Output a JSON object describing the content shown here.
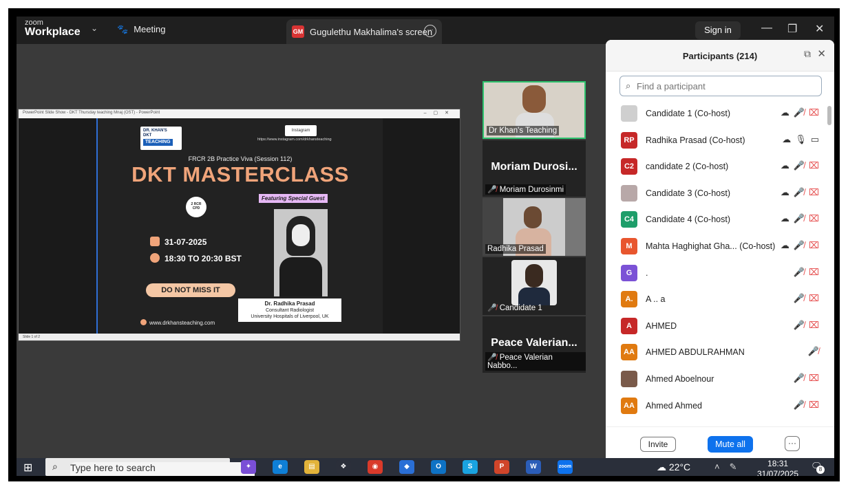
{
  "titlebar": {
    "logo_line1": "zoom",
    "logo_line2": "Workplace",
    "meeting_label": "Meeting",
    "share_tab_avatar": "GM",
    "share_tab_label": "Gugulethu Makhalima's screen",
    "signin_label": "Sign in"
  },
  "slide": {
    "window_title": "PowerPoint Slide Show - DKT Thursday teaching Mnaj (OST) - PowerPoint",
    "footer": "Slide 1 of 2",
    "logo_top": "DR. KHAN'S",
    "logo_mid": "DKT",
    "logo_brand": "TEACHING",
    "instagram": "Instagram",
    "instagram_url": "https://www.instagram.com/drkhansteaching",
    "subtitle": "FRCR 2B Practice Viva (Session 112)",
    "title": "DKT MASTERCLASS",
    "guest_tag": "Featuring Special Guest",
    "cpd_line1": "2 RCR",
    "cpd_line2": "CPD",
    "date": "31-07-2025",
    "time": "18:30 TO 20:30 BST",
    "cta": "DO NOT MISS IT",
    "guest_name": "Dr. Radhika Prasad",
    "guest_role": "Consultant Radiologist",
    "guest_org": "University Hospitals of Liverpool, UK",
    "website": "www.drkhansteaching.com"
  },
  "video_tiles": [
    {
      "name": "Dr Khan's Teaching"
    },
    {
      "big": "Moriam Durosi...",
      "name": "Moriam Durosinmi"
    },
    {
      "name": "Radhika Prasad"
    },
    {
      "name": "Candidate 1"
    },
    {
      "big": "Peace Valerian...",
      "name": "Peace Valerian Nabbo..."
    }
  ],
  "participants": {
    "title": "Participants (214)",
    "search_placeholder": "Find a participant",
    "rows": [
      {
        "avatar": "",
        "color": "#cfcfcf",
        "name": "Candidate 1 (Co-host)"
      },
      {
        "avatar": "RP",
        "color": "#c62828",
        "name": "Radhika Prasad (Co-host)"
      },
      {
        "avatar": "C2",
        "color": "#c62828",
        "name": "candidate 2 (Co-host)"
      },
      {
        "avatar": "",
        "color": "#b8a8a8",
        "name": "Candidate 3 (Co-host)"
      },
      {
        "avatar": "C4",
        "color": "#1e9e6a",
        "name": "Candidate 4 (Co-host)"
      },
      {
        "avatar": "M",
        "color": "#e8562e",
        "name": "Mahta Haghighat Gha... (Co-host)"
      },
      {
        "avatar": "G",
        "color": "#7b52d6",
        "name": "."
      },
      {
        "avatar": "A.",
        "color": "#e07a10",
        "name": "A .. a"
      },
      {
        "avatar": "A",
        "color": "#c62828",
        "name": "AHMED"
      },
      {
        "avatar": "AA",
        "color": "#e07a10",
        "name": "AHMED ABDULRAHMAN"
      },
      {
        "avatar": "",
        "color": "#7a5a4a",
        "name": "Ahmed Aboelnour"
      },
      {
        "avatar": "AA",
        "color": "#e07a10",
        "name": "Ahmed Ahmed"
      }
    ],
    "invite_label": "Invite",
    "mute_all_label": "Mute all",
    "more_label": "···"
  },
  "taskbar": {
    "search_placeholder": "Type here to search",
    "temperature": "22°C",
    "time": "18:31",
    "date": "31/07/2025",
    "notifications": "8",
    "app_zoom": "zoom"
  }
}
